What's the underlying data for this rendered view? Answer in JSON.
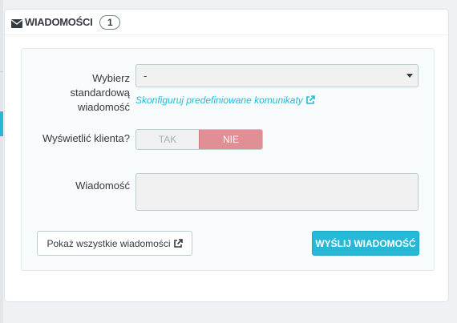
{
  "panel": {
    "title": "WIADOMOŚCI",
    "count": "1",
    "icon": "envelope-icon"
  },
  "form": {
    "template_label": "Wybierz standardową wiadomość",
    "template_value": "-",
    "configure_link": "Skonfiguruj predefiniowane komunikaty",
    "show_customer_label": "Wyświetlić klienta?",
    "toggle_yes": "TAK",
    "toggle_no": "NIE",
    "toggle_selected": "NIE",
    "message_label": "Wiadomość",
    "message_value": ""
  },
  "actions": {
    "show_all_label": "Pokaż wszystkie wiadomości",
    "send_label": "WYŚLIJ WIADOMOŚĆ"
  },
  "colors": {
    "accent": "#25b9d7",
    "toggle_no_bg": "#e08f95",
    "page_bg": "#eff1f2"
  }
}
